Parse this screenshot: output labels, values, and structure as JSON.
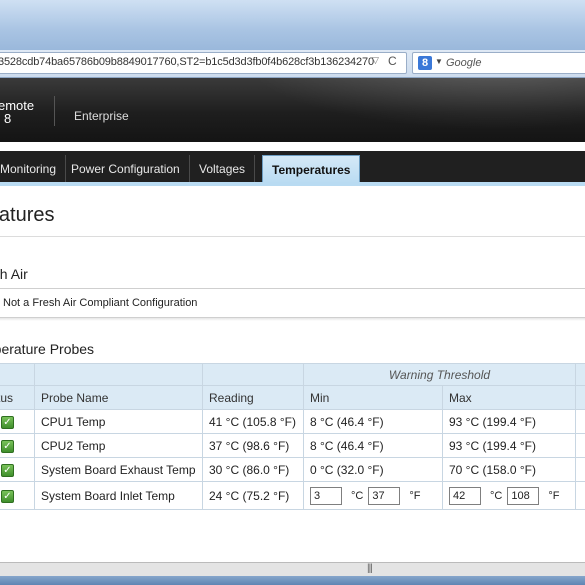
{
  "browser": {
    "url": "3528cdb74ba65786b09b8849017760,ST2=b1c5d3d3fb0f4b628cf3b136234270",
    "search_placeholder": "Google",
    "reload_icon": "reload-icon",
    "search_engine_icon": "google-icon"
  },
  "banner": {
    "brand_line1": "emote",
    "brand_line2": "8",
    "edition": "Enterprise"
  },
  "tabs": [
    {
      "label": "Monitoring",
      "active": false
    },
    {
      "label": "Power Configuration",
      "active": false
    },
    {
      "label": "Voltages",
      "active": false
    },
    {
      "label": "Temperatures",
      "active": true
    }
  ],
  "page": {
    "title": "Temperatures",
    "title_visible": "peratures",
    "fresh_air": {
      "heading": "esh Air",
      "message": "Not a Fresh Air Compliant Configuration"
    },
    "probes": {
      "heading": "mperature Probes",
      "warning_threshold_label": "Warning Threshold",
      "columns": {
        "status": "tus",
        "name": "Probe Name",
        "reading": "Reading",
        "min": "Min",
        "max": "Max"
      },
      "rows": [
        {
          "name": "CPU1 Temp",
          "reading": "41 °C (105.8 °F)",
          "min": "8 °C (46.4 °F)",
          "max": "93 °C (199.4 °F)"
        },
        {
          "name": "CPU2 Temp",
          "reading": "37 °C (98.6 °F)",
          "min": "8 °C (46.4 °F)",
          "max": "93 °C (199.4 °F)"
        },
        {
          "name": "System Board Exhaust Temp",
          "reading": "30 °C (86.0 °F)",
          "min": "0 °C (32.0 °F)",
          "max": "70 °C (158.0 °F)"
        },
        {
          "name": "System Board Inlet Temp",
          "reading": "24 °C (75.2 °F)",
          "min_c": "3",
          "min_f": "37",
          "max_c": "42",
          "max_f": "108",
          "unit_c": "°C",
          "unit_f": "°F"
        }
      ]
    }
  },
  "colors": {
    "tab_active_bg": "#b9dbf2",
    "banner_bg": "#1e1e1e",
    "status_ok": "#4a9d35"
  }
}
